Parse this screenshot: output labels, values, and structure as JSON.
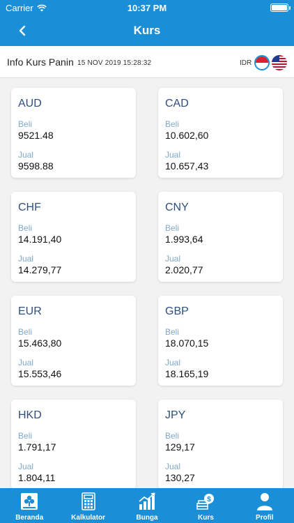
{
  "status": {
    "carrier": "Carrier",
    "time": "10:37 PM"
  },
  "navbar": {
    "title": "Kurs"
  },
  "info": {
    "title": "Info Kurs Panin",
    "date": "15 NOV 2019 15:28:32",
    "currency": "IDR"
  },
  "labels": {
    "buy": "Beli",
    "sell": "Jual"
  },
  "rates": [
    {
      "code": "AUD",
      "buy": "9521.48",
      "sell": "9598.88"
    },
    {
      "code": "CAD",
      "buy": "10.602,60",
      "sell": "10.657,43"
    },
    {
      "code": "CHF",
      "buy": "14.191,40",
      "sell": "14.279,77"
    },
    {
      "code": "CNY",
      "buy": "1.993,64",
      "sell": "2.020,77"
    },
    {
      "code": "EUR",
      "buy": "15.463,80",
      "sell": "15.553,46"
    },
    {
      "code": "GBP",
      "buy": "18.070,15",
      "sell": "18.165,19"
    },
    {
      "code": "HKD",
      "buy": "1.791,17",
      "sell": "1.804,11"
    },
    {
      "code": "JPY",
      "buy": "129,17",
      "sell": "130,27"
    }
  ],
  "tabs": [
    {
      "label": "Beranda",
      "icon": "home-logo-icon"
    },
    {
      "label": "Kalkulator",
      "icon": "calculator-icon"
    },
    {
      "label": "Bunga",
      "icon": "bar-chart-icon"
    },
    {
      "label": "Kurs",
      "icon": "money-stack-icon"
    },
    {
      "label": "Profil",
      "icon": "person-icon"
    }
  ],
  "colors": {
    "primary": "#1a8fd8",
    "currency_code": "#2d4f7f",
    "label": "#7fa8c9",
    "background": "#f2f2f2"
  }
}
